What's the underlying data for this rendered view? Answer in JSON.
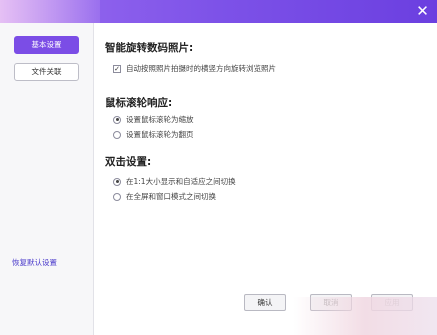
{
  "window": {
    "close_symbol": "✕"
  },
  "sidebar": {
    "items": [
      {
        "label": "基本设置",
        "active": true
      },
      {
        "label": "文件关联",
        "active": false
      }
    ],
    "restore_link": "恢复默认设置"
  },
  "sections": {
    "rotate": {
      "title": "智能旋转数码照片:",
      "option": {
        "label": "自动按照照片拍摄时的横竖方向旋转浏览照片",
        "checked": true
      }
    },
    "wheel": {
      "title": "鼠标滚轮响应:",
      "options": [
        {
          "label": "设置鼠标滚轮为缩放",
          "selected": true
        },
        {
          "label": "设置鼠标滚轮为翻页",
          "selected": false
        }
      ]
    },
    "dblclick": {
      "title": "双击设置:",
      "options": [
        {
          "label": "在1:1大小显示和自适应之间切换",
          "selected": true
        },
        {
          "label": "在全屏和窗口模式之间切换",
          "selected": false
        }
      ]
    }
  },
  "footer": {
    "ok_label": "确认",
    "cancel_label": "取消",
    "apply_label": "应用"
  },
  "colors": {
    "accent": "#7b4de6",
    "link": "#4a3acb"
  }
}
